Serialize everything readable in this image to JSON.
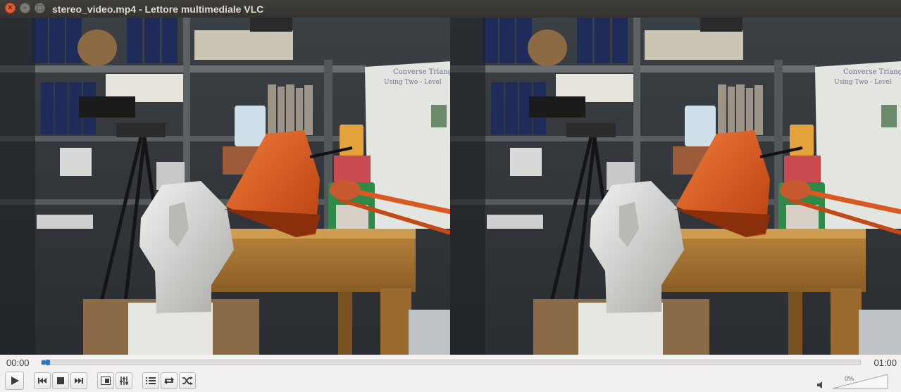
{
  "window": {
    "title": "stereo_video.mp4 - Lettore multimediale VLC"
  },
  "player": {
    "elapsed": "00:00",
    "total": "01:00",
    "progress": 0.005,
    "volume_text": "0%",
    "volume_level": 0
  },
  "colors": {
    "accent": "#2a76c6",
    "titlebar": "#3a3935",
    "close": "#e95b2a",
    "lamp": "#d9531e"
  },
  "icons": {
    "close": "close-icon",
    "minimize": "minimize-icon",
    "maximize": "maximize-icon",
    "play": "play-icon",
    "previous": "previous-icon",
    "stop": "stop-icon",
    "next": "next-icon",
    "fullscreen": "fullscreen-icon",
    "extended": "equalizer-icon",
    "playlist": "playlist-icon",
    "loop": "loop-icon",
    "shuffle": "shuffle-icon",
    "volume": "speaker-icon"
  }
}
